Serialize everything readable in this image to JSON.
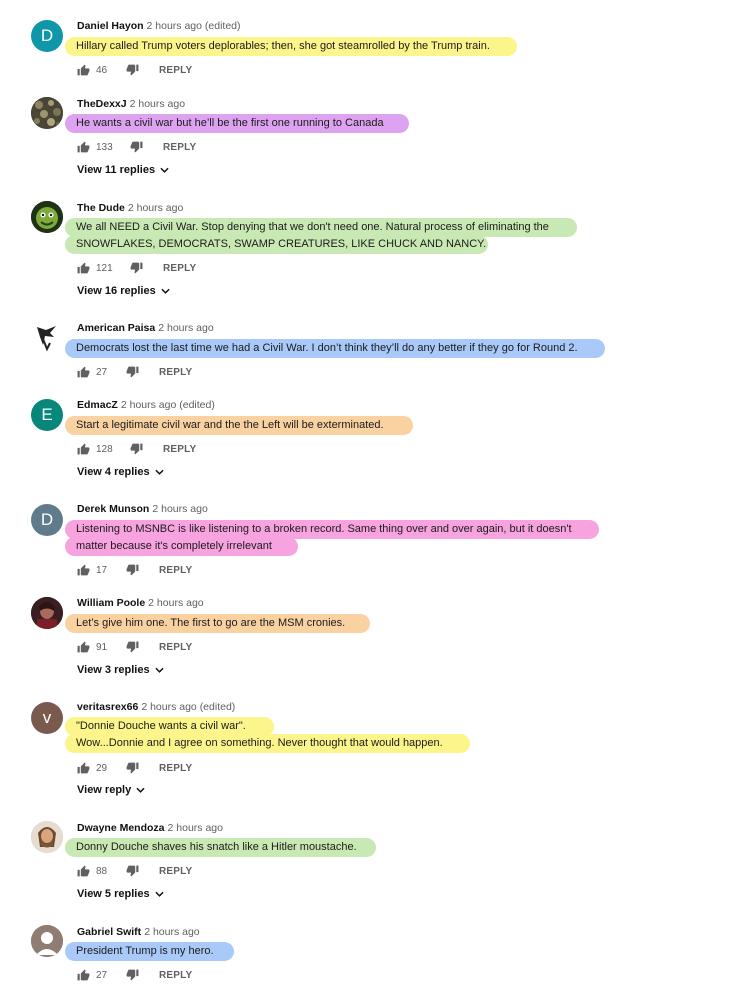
{
  "icons": {
    "like": "thumbs-up-icon",
    "dislike": "thumbs-down-icon",
    "expand": "chevron-down-icon"
  },
  "reply_label": "REPLY",
  "comments": [
    {
      "author": "Daniel Hayon",
      "time": "2 hours ago (edited)",
      "avatar": {
        "type": "letter",
        "letter": "D",
        "color": "#0f96a8"
      },
      "lines": [
        "Hillary called Trump voters deplorables; then, she got steamrolled by the Trump train."
      ],
      "highlight": "#fcf58b",
      "likes": "46",
      "view_replies": ""
    },
    {
      "author": "TheDexxJ",
      "time": "2 hours ago",
      "avatar": {
        "type": "image",
        "icon": "snake-skin-avatar"
      },
      "lines": [
        "He wants a civil war but he’ll be the first one running to Canada"
      ],
      "highlight": "#dea3f0",
      "likes": "133",
      "view_replies": "View 11 replies"
    },
    {
      "author": "The Dude",
      "time": "2 hours ago",
      "avatar": {
        "type": "image",
        "icon": "green-face-avatar"
      },
      "lines": [
        "We all NEED a Civil War. Stop denying that we don't need one. Natural process of eliminating the",
        "SNOWFLAKES, DEMOCRATS, SWAMP CREATURES, LIKE CHUCK AND NANCY."
      ],
      "highlight": "#c9e9b4",
      "likes": "121",
      "view_replies": "View 16 replies"
    },
    {
      "author": "American Paisa",
      "time": "2 hours ago",
      "avatar": {
        "type": "image",
        "icon": "sketch-figure-avatar"
      },
      "lines": [
        "Democrats lost the last time we had a Civil War. I don’t think they’ll do any better if they go for Round 2."
      ],
      "highlight": "#a9caf9",
      "likes": "27",
      "view_replies": ""
    },
    {
      "author": "EdmacZ",
      "time": "2 hours ago (edited)",
      "avatar": {
        "type": "letter",
        "letter": "E",
        "color": "#07867a"
      },
      "lines": [
        "Start a legitimate civil war and the the Left will be exterminated."
      ],
      "highlight": "#fad2a2",
      "likes": "128",
      "view_replies": "View 4 replies"
    },
    {
      "author": "Derek Munson",
      "time": "2 hours ago",
      "avatar": {
        "type": "letter",
        "letter": "D",
        "color": "#5f7b8c"
      },
      "lines": [
        "Listening to MSNBC is like listening to a broken record. Same thing over and over again, but it doesn't",
        "matter because it's completely irrelevant"
      ],
      "highlight": "#f7a3df",
      "likes": "17",
      "view_replies": ""
    },
    {
      "author": "William Poole",
      "time": "2 hours ago",
      "avatar": {
        "type": "image",
        "icon": "portrait-avatar"
      },
      "lines": [
        "Let’s give him one. The first to go are the MSM cronies."
      ],
      "highlight": "#fad2a2",
      "likes": "91",
      "view_replies": "View 3 replies"
    },
    {
      "author": "veritasrex66",
      "time": "2 hours ago (edited)",
      "avatar": {
        "type": "letter",
        "letter": "v",
        "color": "#7a5a4e"
      },
      "lines": [
        "\"Donnie Douche wants a civil war\".",
        "Wow...Donnie and I agree on something. Never thought that would happen."
      ],
      "highlight": "#fcf58b",
      "likes": "29",
      "view_replies": "View reply"
    },
    {
      "author": "Dwayne Mendoza",
      "time": "2 hours ago",
      "avatar": {
        "type": "image",
        "icon": "bearded-face-avatar"
      },
      "lines": [
        "Donny Douche shaves his snatch like a Hitler moustache."
      ],
      "highlight": "#c9e9b4",
      "likes": "88",
      "view_replies": "View 5 replies"
    },
    {
      "author": "Gabriel Swift",
      "time": "2 hours ago",
      "avatar": {
        "type": "image",
        "icon": "default-user-avatar"
      },
      "lines": [
        "President Trump is my hero."
      ],
      "highlight": "#a9caf9",
      "likes": "27",
      "view_replies": ""
    }
  ]
}
